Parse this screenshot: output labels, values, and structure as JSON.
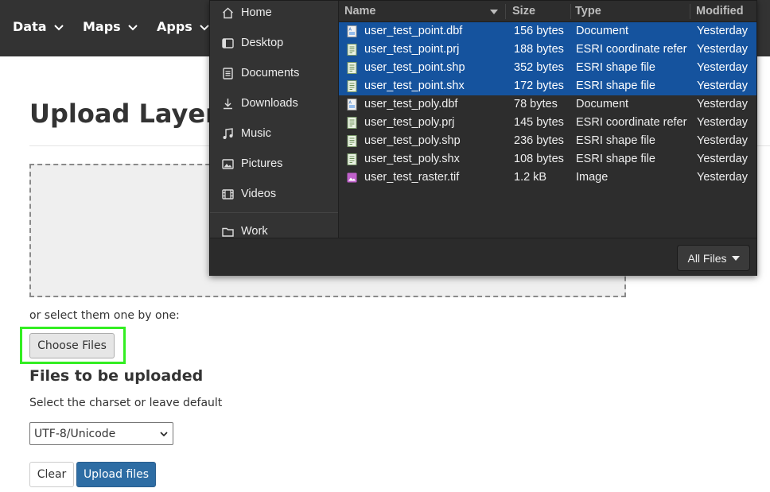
{
  "nav": {
    "items": [
      {
        "label": "Data"
      },
      {
        "label": "Maps"
      },
      {
        "label": "Apps"
      }
    ]
  },
  "page": {
    "title": "Upload Layers",
    "or_select_text": "or select them one by one:",
    "choose_files_label": "Choose Files",
    "files_heading": "Files to be uploaded",
    "charset_label": "Select the charset or leave default",
    "charset_value": "UTF-8/Unicode",
    "clear_label": "Clear",
    "upload_label": "Upload files"
  },
  "dialog": {
    "places": [
      {
        "label": "Home",
        "icon": "home-icon"
      },
      {
        "label": "Desktop",
        "icon": "desktop-icon"
      },
      {
        "label": "Documents",
        "icon": "documents-icon"
      },
      {
        "label": "Downloads",
        "icon": "downloads-icon"
      },
      {
        "label": "Music",
        "icon": "music-icon"
      },
      {
        "label": "Pictures",
        "icon": "pictures-icon"
      },
      {
        "label": "Videos",
        "icon": "videos-icon"
      },
      {
        "label": "Work",
        "icon": "folder-icon"
      }
    ],
    "columns": {
      "name": "Name",
      "size": "Size",
      "type": "Type",
      "modified": "Modified"
    },
    "files": [
      {
        "name": "user_test_point.dbf",
        "size": "156 bytes",
        "type": "Document",
        "modified": "Yesterday",
        "selected": true,
        "icon": "document-file-icon"
      },
      {
        "name": "user_test_point.prj",
        "size": "188 bytes",
        "type": "ESRI coordinate refer",
        "modified": "Yesterday",
        "selected": true,
        "icon": "esri-file-icon"
      },
      {
        "name": "user_test_point.shp",
        "size": "352 bytes",
        "type": "ESRI shape file",
        "modified": "Yesterday",
        "selected": true,
        "icon": "esri-file-icon"
      },
      {
        "name": "user_test_point.shx",
        "size": "172 bytes",
        "type": "ESRI shape file",
        "modified": "Yesterday",
        "selected": true,
        "icon": "esri-file-icon"
      },
      {
        "name": "user_test_poly.dbf",
        "size": "78 bytes",
        "type": "Document",
        "modified": "Yesterday",
        "selected": false,
        "icon": "document-file-icon"
      },
      {
        "name": "user_test_poly.prj",
        "size": "145 bytes",
        "type": "ESRI coordinate refer",
        "modified": "Yesterday",
        "selected": false,
        "icon": "esri-file-icon"
      },
      {
        "name": "user_test_poly.shp",
        "size": "236 bytes",
        "type": "ESRI shape file",
        "modified": "Yesterday",
        "selected": false,
        "icon": "esri-file-icon"
      },
      {
        "name": "user_test_poly.shx",
        "size": "108 bytes",
        "type": "ESRI shape file",
        "modified": "Yesterday",
        "selected": false,
        "icon": "esri-file-icon"
      },
      {
        "name": "user_test_raster.tif",
        "size": "1.2 kB",
        "type": "Image",
        "modified": "Yesterday",
        "selected": false,
        "icon": "image-file-icon"
      }
    ],
    "filter_label": "All Files"
  },
  "colors": {
    "nav_bg": "#333333",
    "selection": "#15539e",
    "highlight_outline": "#33ee22",
    "primary_button": "#2e6da4"
  }
}
